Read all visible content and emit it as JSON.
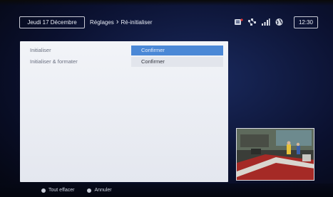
{
  "header": {
    "date": "Jeudi 17 Décembre",
    "breadcrumb": [
      "Réglages",
      "Ré-initialiser"
    ],
    "time": "12:30",
    "status_icons": [
      "recording-icon",
      "network-icon",
      "signal-bars-icon",
      "globe-icon"
    ]
  },
  "menu": {
    "rows": [
      {
        "label": "Initialiser",
        "action": "Confirmer",
        "selected": true
      },
      {
        "label": "Initialiser & formater",
        "action": "Confirmer",
        "selected": false
      }
    ]
  },
  "footer": {
    "hints": [
      {
        "key": "button-dot-icon",
        "label": "Tout effacer"
      },
      {
        "key": "button-dot-icon",
        "label": "Annuler"
      }
    ]
  },
  "colors": {
    "selected_action": "#4b88d6",
    "panel": "#eef0f5",
    "background": "#0b1130"
  }
}
